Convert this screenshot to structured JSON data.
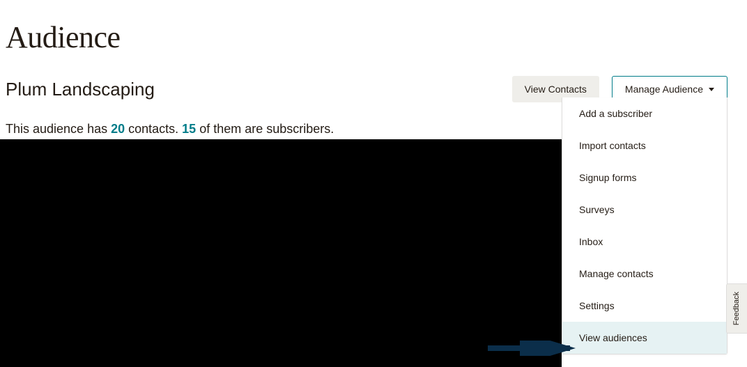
{
  "page_title": "Audience",
  "audience_name": "Plum Landscaping",
  "buttons": {
    "view_contacts": "View Contacts",
    "manage_audience": "Manage Audience"
  },
  "stats": {
    "prefix": "This audience has ",
    "contacts_count": "20",
    "mid1": " contacts. ",
    "subscribers_count": "15",
    "suffix": " of them are subscribers."
  },
  "dropdown": {
    "items": [
      {
        "label": "Add a subscriber"
      },
      {
        "label": "Import contacts"
      },
      {
        "label": "Signup forms"
      },
      {
        "label": "Surveys"
      },
      {
        "label": "Inbox"
      },
      {
        "label": "Manage contacts"
      },
      {
        "label": "Settings"
      },
      {
        "label": "View audiences"
      }
    ]
  },
  "feedback_label": "Feedback",
  "colors": {
    "accent": "#007c89",
    "text": "#241c15",
    "secondary_bg": "#efeeea",
    "highlight": "#e6f2f3"
  }
}
